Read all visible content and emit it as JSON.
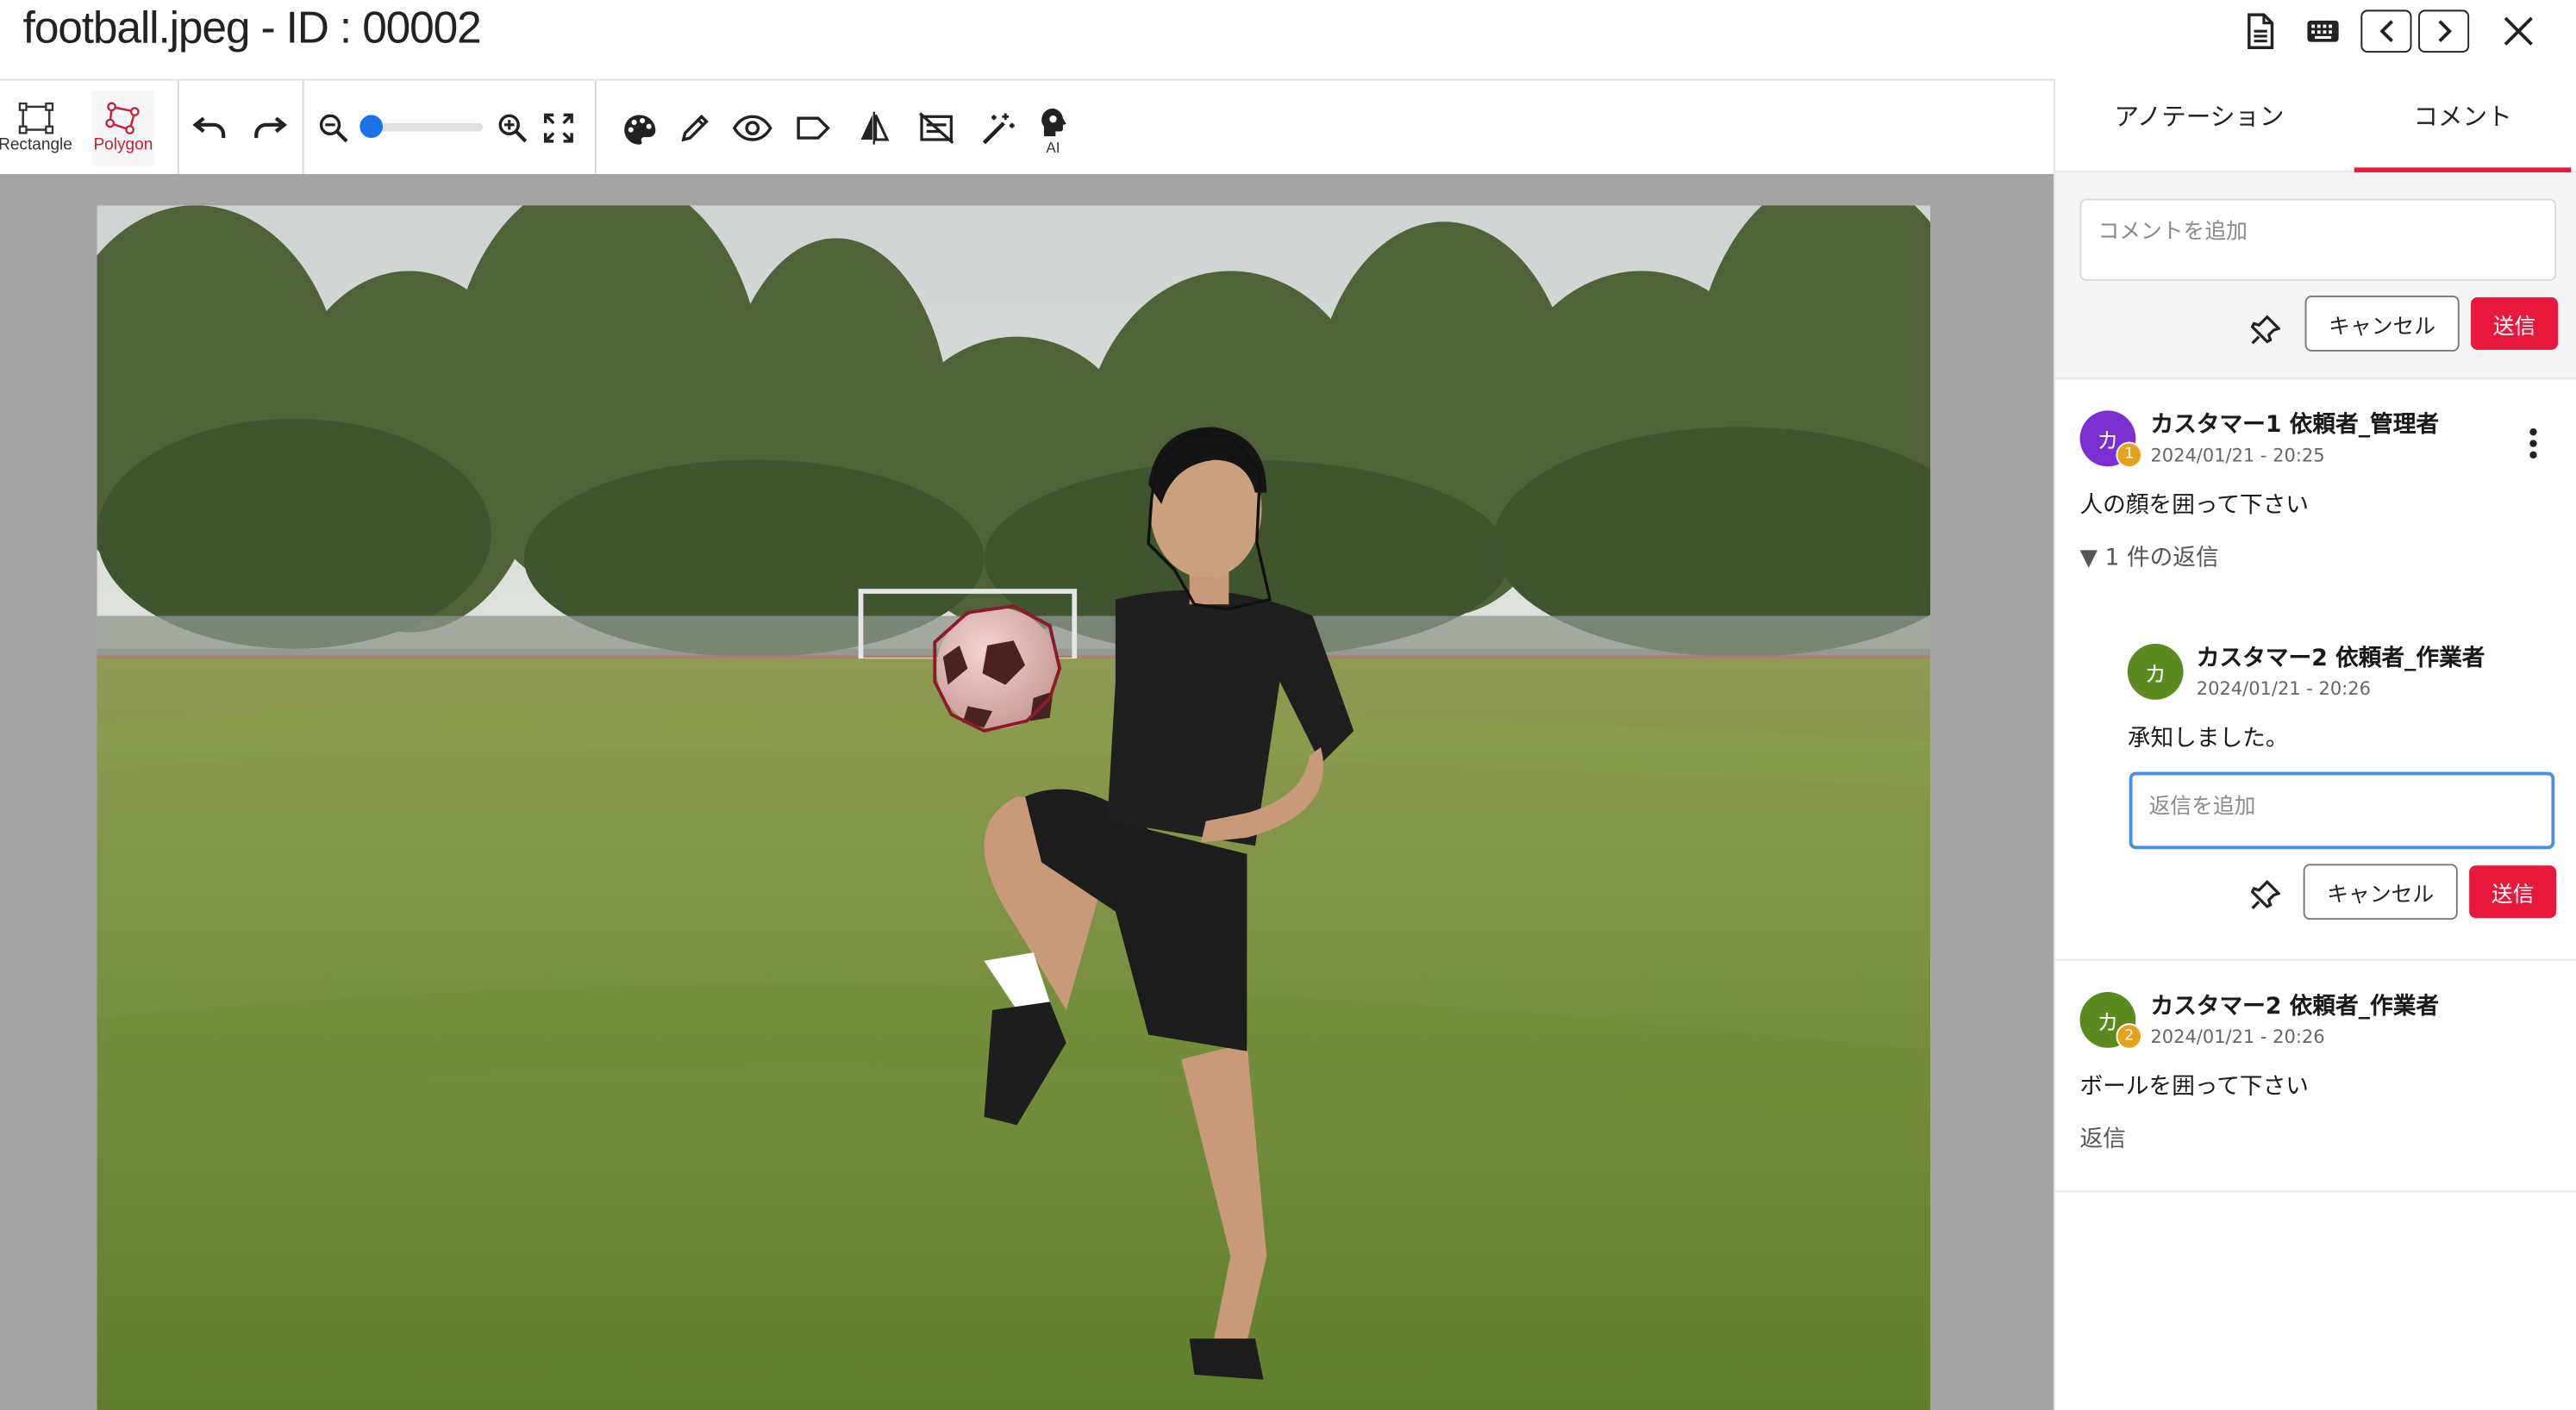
{
  "window": {
    "title": "football.jpeg - ID : 00002"
  },
  "titlebar": {
    "icons": [
      "document-icon",
      "keyboard-icon",
      "chevron-left-icon",
      "chevron-right-icon",
      "close-icon"
    ]
  },
  "toolbar": {
    "rectangle_label": "Rectangle",
    "polygon_label": "Polygon",
    "ai_label": "AI",
    "zoom_level": 0.05,
    "icons": [
      "undo-icon",
      "redo-icon",
      "zoom-out-icon",
      "zoom-in-icon",
      "fit-screen-icon",
      "palette-icon",
      "pencil-icon",
      "eye-icon",
      "label-icon",
      "flip-icon",
      "hide-labels-icon",
      "magic-wand-icon",
      "ai-brain-icon"
    ]
  },
  "panel": {
    "tabs": [
      {
        "label": "アノテーション",
        "active": false
      },
      {
        "label": "コメント",
        "active": true
      }
    ],
    "composer": {
      "placeholder": "コメントを追加",
      "cancel_label": "キャンセル",
      "send_label": "送信"
    },
    "comments": [
      {
        "avatar": "カ",
        "avatar_color": "#7b2fd1",
        "badge": "1",
        "author": "カスタマー1 依頼者_管理者",
        "date": "2024/01/21 - 20:25",
        "text": "人の顔を囲って下さい",
        "replies_toggle": "▼ 1 件の返信",
        "replies": [
          {
            "avatar": "カ",
            "avatar_color": "#5b8a1e",
            "author": "カスタマー2 依頼者_作業者",
            "date": "2024/01/21 - 20:26",
            "text": "承知しました。"
          }
        ],
        "reply_box": {
          "placeholder": "返信を追加",
          "cancel_label": "キャンセル",
          "send_label": "送信"
        }
      },
      {
        "avatar": "カ",
        "avatar_color": "#5b8a1e",
        "badge": "2",
        "author": "カスタマー2 依頼者_作業者",
        "date": "2024/01/21 - 20:26",
        "text": "ボールを囲って下さい",
        "reply_link": "返信"
      }
    ]
  },
  "colors": {
    "accent": "#e8173c",
    "zoom_knob": "#1a73e8",
    "badge": "#e6a21b"
  }
}
